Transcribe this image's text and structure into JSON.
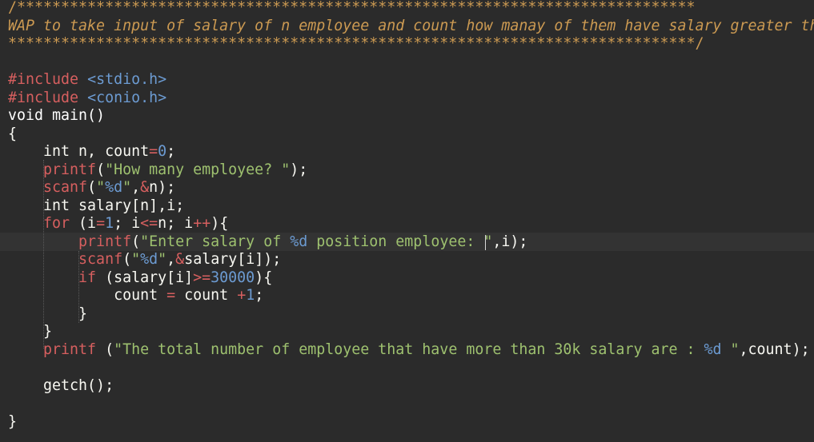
{
  "editor": {
    "colors": {
      "background": "#2b2b2b",
      "comment": "#cc9a52",
      "keyword": "#d65f5f",
      "string": "#9ec16f",
      "number": "#6c9bd2",
      "text": "#f8f8f2"
    },
    "lines": {
      "l1": "/*****************************************************************************",
      "l2": "WAP to take input of salary of n employee and count how manay of them have salary greater th",
      "l3": "******************************************************************************/",
      "l5a": "#include ",
      "l5b": "<stdio.h>",
      "l6a": "#include ",
      "l6b": "<conio.h>",
      "l7": "void main()",
      "l8": "{",
      "l9a": "    int n, count",
      "l9b": "=",
      "l9c": "0",
      "l9d": ";",
      "l10a": "    printf",
      "l10b": "(",
      "l10c": "\"How many employee? \"",
      "l10d": ");",
      "l11a": "    scanf",
      "l11b": "(",
      "l11c": "\"",
      "l11d": "%d",
      "l11e": "\"",
      "l11f": ",",
      "l11g": "&",
      "l11h": "n);",
      "l12": "    int salary[n],i;",
      "l13a": "    for",
      "l13b": " (i",
      "l13c": "=",
      "l13d": "1",
      "l13e": "; i",
      "l13f": "<=",
      "l13g": "n; i",
      "l13h": "++",
      "l13i": "){",
      "l14a": "        printf",
      "l14b": "(",
      "l14c": "\"Enter salary of ",
      "l14d": "%d",
      "l14e": " position employee: \"",
      "l14f": ",i);",
      "l15a": "        scanf",
      "l15b": "(",
      "l15c": "\"",
      "l15d": "%d",
      "l15e": "\"",
      "l15f": ",",
      "l15g": "&",
      "l15h": "salary[i]);",
      "l16a": "        if",
      "l16b": " (salary[i]",
      "l16c": ">=",
      "l16d": "30000",
      "l16e": "){",
      "l17a": "            count ",
      "l17b": "=",
      "l17c": " count ",
      "l17d": "+",
      "l17e": "1",
      "l17f": ";",
      "l18": "        }",
      "l19": "    }",
      "l20a": "    printf",
      "l20b": " (",
      "l20c": "\"The total number of employee that have more than 30k salary are : ",
      "l20d": "%d",
      "l20e": " \"",
      "l20f": ",count);",
      "l22": "    getch();",
      "l24": "}"
    }
  }
}
